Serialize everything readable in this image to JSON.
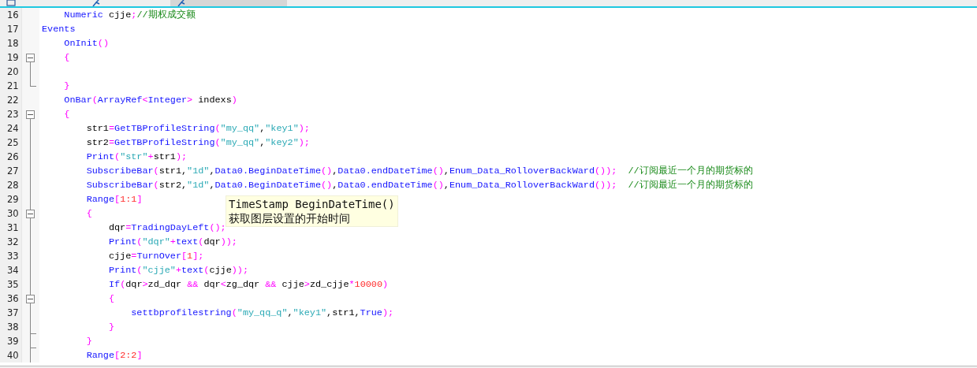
{
  "tabs": [
    {
      "selected": false,
      "kind": "list"
    },
    {
      "selected": false,
      "kind": "pinned"
    },
    {
      "selected": true,
      "kind": "pinned"
    }
  ],
  "editor": {
    "lines": [
      {
        "number": "16",
        "kind": "none",
        "tokens": [
          {
            "kind": "kw",
            "text": "    Numeric"
          },
          {
            "kind": "id",
            "text": " cjje"
          },
          {
            "kind": "op",
            "text": ";"
          },
          {
            "kind": "cmt",
            "text": "//期权成交额"
          }
        ]
      },
      {
        "number": "17",
        "kind": "none",
        "tokens": [
          {
            "kind": "kw",
            "text": "Events"
          }
        ]
      },
      {
        "number": "18",
        "kind": "none",
        "tokens": [
          {
            "kind": "kw",
            "text": "    OnInit"
          },
          {
            "kind": "op",
            "text": "()"
          }
        ]
      },
      {
        "number": "19",
        "kind": "open",
        "tokens": [
          {
            "kind": "op",
            "text": "    {"
          }
        ]
      },
      {
        "number": "20",
        "kind": "line"
      },
      {
        "number": "21",
        "kind": "close",
        "tokens": [
          {
            "kind": "op",
            "text": "    }"
          }
        ]
      },
      {
        "number": "22",
        "kind": "none",
        "tokens": [
          {
            "kind": "kw",
            "text": "    OnBar"
          },
          {
            "kind": "op",
            "text": "("
          },
          {
            "kind": "kw",
            "text": "ArrayRef"
          },
          {
            "kind": "op",
            "text": "<"
          },
          {
            "kind": "kw",
            "text": "Integer"
          },
          {
            "kind": "op",
            "text": ">"
          },
          {
            "kind": "id",
            "text": " indexs"
          },
          {
            "kind": "op",
            "text": ")"
          }
        ]
      },
      {
        "number": "23",
        "kind": "open",
        "tokens": [
          {
            "kind": "op",
            "text": "    {"
          }
        ]
      },
      {
        "number": "24",
        "kind": "line",
        "tokens": [
          {
            "kind": "id",
            "text": "        str1"
          },
          {
            "kind": "op",
            "text": "="
          },
          {
            "kind": "kw",
            "text": "GetTBProfileString"
          },
          {
            "kind": "op",
            "text": "("
          },
          {
            "kind": "str",
            "text": "\"my_qq\""
          },
          {
            "kind": "id",
            "text": ","
          },
          {
            "kind": "str",
            "text": "\"key1\""
          },
          {
            "kind": "op",
            "text": ");"
          }
        ]
      },
      {
        "number": "25",
        "kind": "line",
        "tokens": [
          {
            "kind": "id",
            "text": "        str2"
          },
          {
            "kind": "op",
            "text": "="
          },
          {
            "kind": "kw",
            "text": "GetTBProfileString"
          },
          {
            "kind": "op",
            "text": "("
          },
          {
            "kind": "str",
            "text": "\"my_qq\""
          },
          {
            "kind": "id",
            "text": ","
          },
          {
            "kind": "str",
            "text": "\"key2\""
          },
          {
            "kind": "op",
            "text": ");"
          }
        ]
      },
      {
        "number": "26",
        "kind": "line",
        "tokens": [
          {
            "kind": "kw",
            "text": "        Print"
          },
          {
            "kind": "op",
            "text": "("
          },
          {
            "kind": "str",
            "text": "\"str\""
          },
          {
            "kind": "op",
            "text": "+"
          },
          {
            "kind": "id",
            "text": "str1"
          },
          {
            "kind": "op",
            "text": ");"
          }
        ]
      },
      {
        "number": "27",
        "kind": "line",
        "tokens": [
          {
            "kind": "kw",
            "text": "        SubscribeBar"
          },
          {
            "kind": "op",
            "text": "("
          },
          {
            "kind": "id",
            "text": "str1,"
          },
          {
            "kind": "str",
            "text": "\"1d\""
          },
          {
            "kind": "id",
            "text": ","
          },
          {
            "kind": "kw",
            "text": "Data0.BeginDateTime"
          },
          {
            "kind": "op",
            "text": "()"
          },
          {
            "kind": "id",
            "text": ","
          },
          {
            "kind": "kw",
            "text": "Data0.endDateTime"
          },
          {
            "kind": "op",
            "text": "()"
          },
          {
            "kind": "id",
            "text": ","
          },
          {
            "kind": "kw",
            "text": "Enum_Data_RolloverBackWard"
          },
          {
            "kind": "op",
            "text": "());"
          },
          {
            "kind": "cmt",
            "text": "  //订阅最近一个月的期货标的"
          }
        ]
      },
      {
        "number": "28",
        "kind": "line",
        "tokens": [
          {
            "kind": "kw",
            "text": "        SubscribeBar"
          },
          {
            "kind": "op",
            "text": "("
          },
          {
            "kind": "id",
            "text": "str2,"
          },
          {
            "kind": "str",
            "text": "\"1d\""
          },
          {
            "kind": "id",
            "text": ","
          },
          {
            "kind": "kw",
            "text": "Data0.BeginDateTime"
          },
          {
            "kind": "op",
            "text": "()"
          },
          {
            "kind": "id",
            "text": ","
          },
          {
            "kind": "kw",
            "text": "Data0.endDateTime"
          },
          {
            "kind": "op",
            "text": "()"
          },
          {
            "kind": "id",
            "text": ","
          },
          {
            "kind": "kw",
            "text": "Enum_Data_RolloverBackWard"
          },
          {
            "kind": "op",
            "text": "());"
          },
          {
            "kind": "cmt",
            "text": "  //订阅最近一个月的期货标的"
          }
        ]
      },
      {
        "number": "29",
        "kind": "line",
        "tokens": [
          {
            "kind": "kw",
            "text": "        Range"
          },
          {
            "kind": "op",
            "text": "["
          },
          {
            "kind": "num",
            "text": "1:1"
          },
          {
            "kind": "op",
            "text": "]"
          }
        ]
      },
      {
        "number": "30",
        "kind": "inner-open",
        "tokens": [
          {
            "kind": "op",
            "text": "        {"
          }
        ]
      },
      {
        "number": "31",
        "kind": "line",
        "tokens": [
          {
            "kind": "id",
            "text": "            dqr"
          },
          {
            "kind": "op",
            "text": "="
          },
          {
            "kind": "kw",
            "text": "TradingDayLeft"
          },
          {
            "kind": "op",
            "text": "();"
          }
        ]
      },
      {
        "number": "32",
        "kind": "line",
        "tokens": [
          {
            "kind": "kw",
            "text": "            Print"
          },
          {
            "kind": "op",
            "text": "("
          },
          {
            "kind": "str",
            "text": "\"dqr\""
          },
          {
            "kind": "op",
            "text": "+"
          },
          {
            "kind": "kw",
            "text": "text"
          },
          {
            "kind": "op",
            "text": "("
          },
          {
            "kind": "id",
            "text": "dqr"
          },
          {
            "kind": "op",
            "text": "));"
          }
        ]
      },
      {
        "number": "33",
        "kind": "line",
        "tokens": [
          {
            "kind": "id",
            "text": "            cjje"
          },
          {
            "kind": "op",
            "text": "="
          },
          {
            "kind": "kw",
            "text": "TurnOver"
          },
          {
            "kind": "op",
            "text": "["
          },
          {
            "kind": "num",
            "text": "1"
          },
          {
            "kind": "op",
            "text": "];"
          }
        ]
      },
      {
        "number": "34",
        "kind": "line",
        "tokens": [
          {
            "kind": "kw",
            "text": "            Print"
          },
          {
            "kind": "op",
            "text": "("
          },
          {
            "kind": "str",
            "text": "\"cjje\""
          },
          {
            "kind": "op",
            "text": "+"
          },
          {
            "kind": "kw",
            "text": "text"
          },
          {
            "kind": "op",
            "text": "("
          },
          {
            "kind": "id",
            "text": "cjje"
          },
          {
            "kind": "op",
            "text": "));"
          }
        ]
      },
      {
        "number": "35",
        "kind": "line",
        "tokens": [
          {
            "kind": "kw",
            "text": "            If"
          },
          {
            "kind": "op",
            "text": "("
          },
          {
            "kind": "id",
            "text": "dqr"
          },
          {
            "kind": "op",
            "text": ">"
          },
          {
            "kind": "id",
            "text": "zd_dqr "
          },
          {
            "kind": "op",
            "text": "&&"
          },
          {
            "kind": "id",
            "text": " dqr"
          },
          {
            "kind": "op",
            "text": "<"
          },
          {
            "kind": "id",
            "text": "zg_dqr "
          },
          {
            "kind": "op",
            "text": "&&"
          },
          {
            "kind": "id",
            "text": " cjje"
          },
          {
            "kind": "op",
            "text": ">"
          },
          {
            "kind": "id",
            "text": "zd_cjje"
          },
          {
            "kind": "op",
            "text": "*"
          },
          {
            "kind": "num",
            "text": "10000"
          },
          {
            "kind": "op",
            "text": ")"
          }
        ]
      },
      {
        "number": "36",
        "kind": "inner-open",
        "tokens": [
          {
            "kind": "op",
            "text": "            {"
          }
        ]
      },
      {
        "number": "37",
        "kind": "line",
        "tokens": [
          {
            "kind": "kw",
            "text": "                settbprofilestring"
          },
          {
            "kind": "op",
            "text": "("
          },
          {
            "kind": "str",
            "text": "\"my_qq_q\""
          },
          {
            "kind": "id",
            "text": ","
          },
          {
            "kind": "str",
            "text": "\"key1\""
          },
          {
            "kind": "id",
            "text": ",str1,"
          },
          {
            "kind": "kw",
            "text": "True"
          },
          {
            "kind": "op",
            "text": ");"
          }
        ]
      },
      {
        "number": "38",
        "kind": "inner-close",
        "tokens": [
          {
            "kind": "op",
            "text": "            }"
          }
        ]
      },
      {
        "number": "39",
        "kind": "inner-close",
        "tokens": [
          {
            "kind": "op",
            "text": "        }"
          }
        ]
      },
      {
        "number": "40",
        "kind": "line",
        "tokens": [
          {
            "kind": "kw",
            "text": "        Range"
          },
          {
            "kind": "op",
            "text": "["
          },
          {
            "kind": "num",
            "text": "2:2"
          },
          {
            "kind": "op",
            "text": "]"
          }
        ]
      }
    ]
  },
  "tooltip": {
    "signature": "TimeStamp BeginDateTime()",
    "description": "获取图层设置的开始时间"
  }
}
